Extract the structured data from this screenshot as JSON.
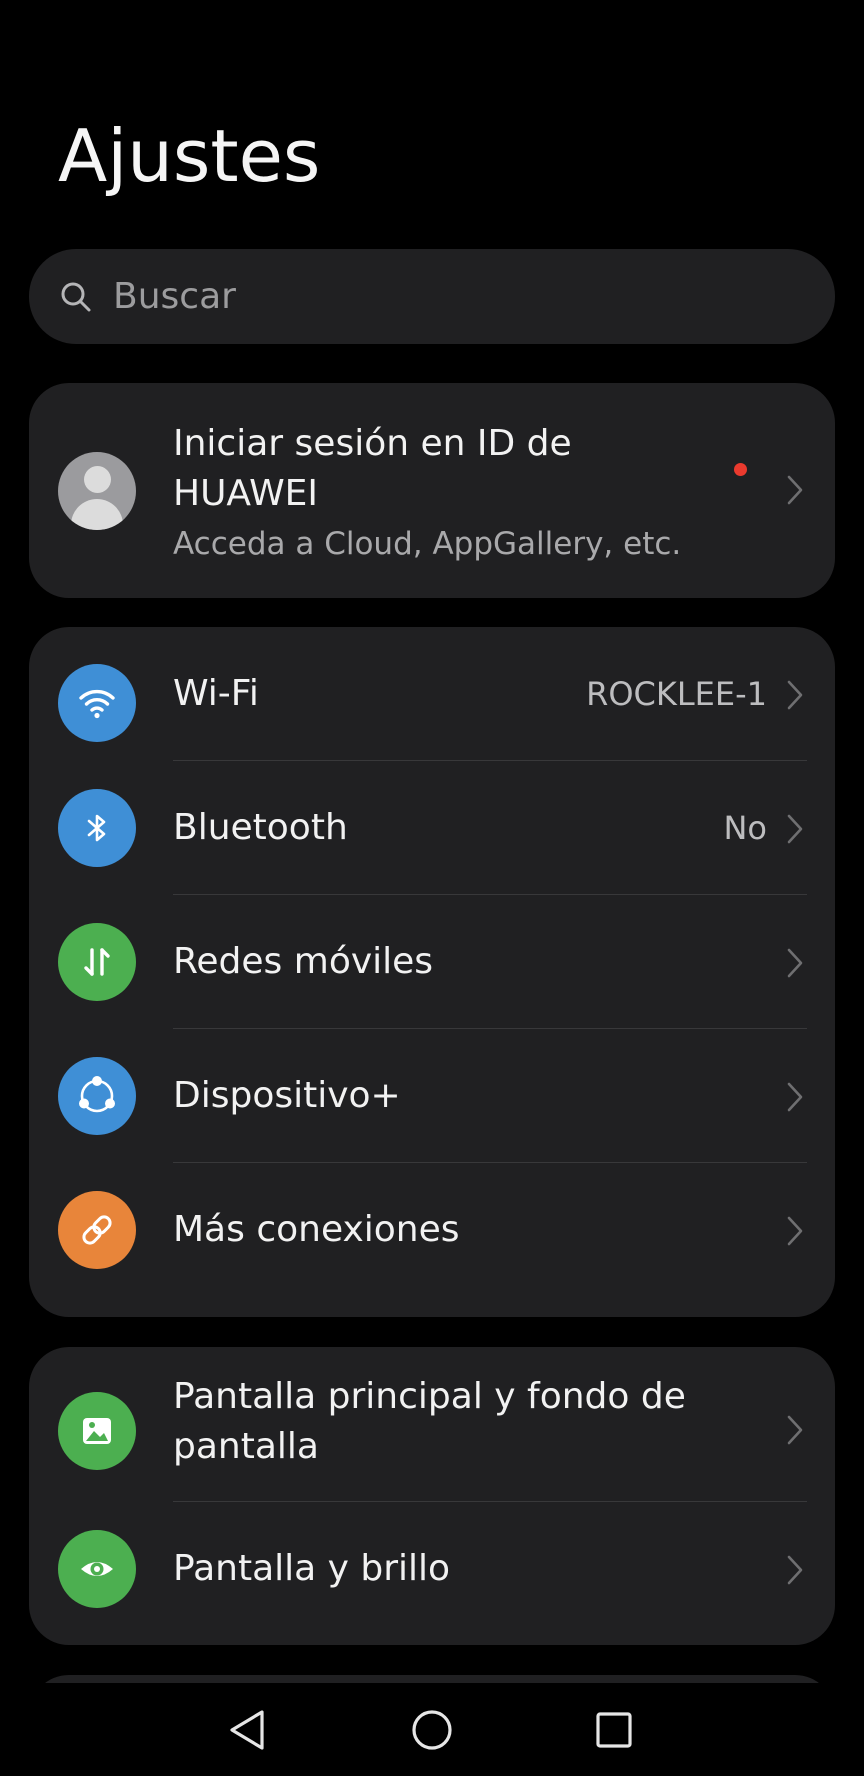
{
  "header": {
    "title": "Ajustes"
  },
  "search": {
    "placeholder": "Buscar",
    "icon": "search-icon"
  },
  "account": {
    "title": "Iniciar sesión en ID de HUAWEI",
    "subtitle": "Acceda a Cloud, AppGallery, etc.",
    "has_notification_dot": true,
    "icon": "avatar-icon"
  },
  "connections": {
    "items": [
      {
        "label": "Wi-Fi",
        "value": "ROCKLEE-1",
        "icon": "wifi-icon",
        "color": "#3f8fd6"
      },
      {
        "label": "Bluetooth",
        "value": "No",
        "icon": "bluetooth-icon",
        "color": "#3f8fd6"
      },
      {
        "label": "Redes móviles",
        "value": "",
        "icon": "mobile-data-icon",
        "color": "#4caf50"
      },
      {
        "label": "Dispositivo+",
        "value": "",
        "icon": "device-plus-icon",
        "color": "#3f8fd6"
      },
      {
        "label": "Más conexiones",
        "value": "",
        "icon": "link-icon",
        "color": "#e8853a"
      }
    ]
  },
  "display": {
    "items": [
      {
        "label": "Pantalla principal y fondo de pantalla",
        "icon": "wallpaper-icon",
        "color": "#4caf50"
      },
      {
        "label": "Pantalla y brillo",
        "icon": "eye-icon",
        "color": "#4caf50"
      }
    ]
  },
  "navigation": {
    "buttons": [
      "back",
      "home",
      "recents"
    ]
  },
  "colors": {
    "background": "#000000",
    "card": "#202022",
    "notification_dot": "#ea3a2e"
  }
}
